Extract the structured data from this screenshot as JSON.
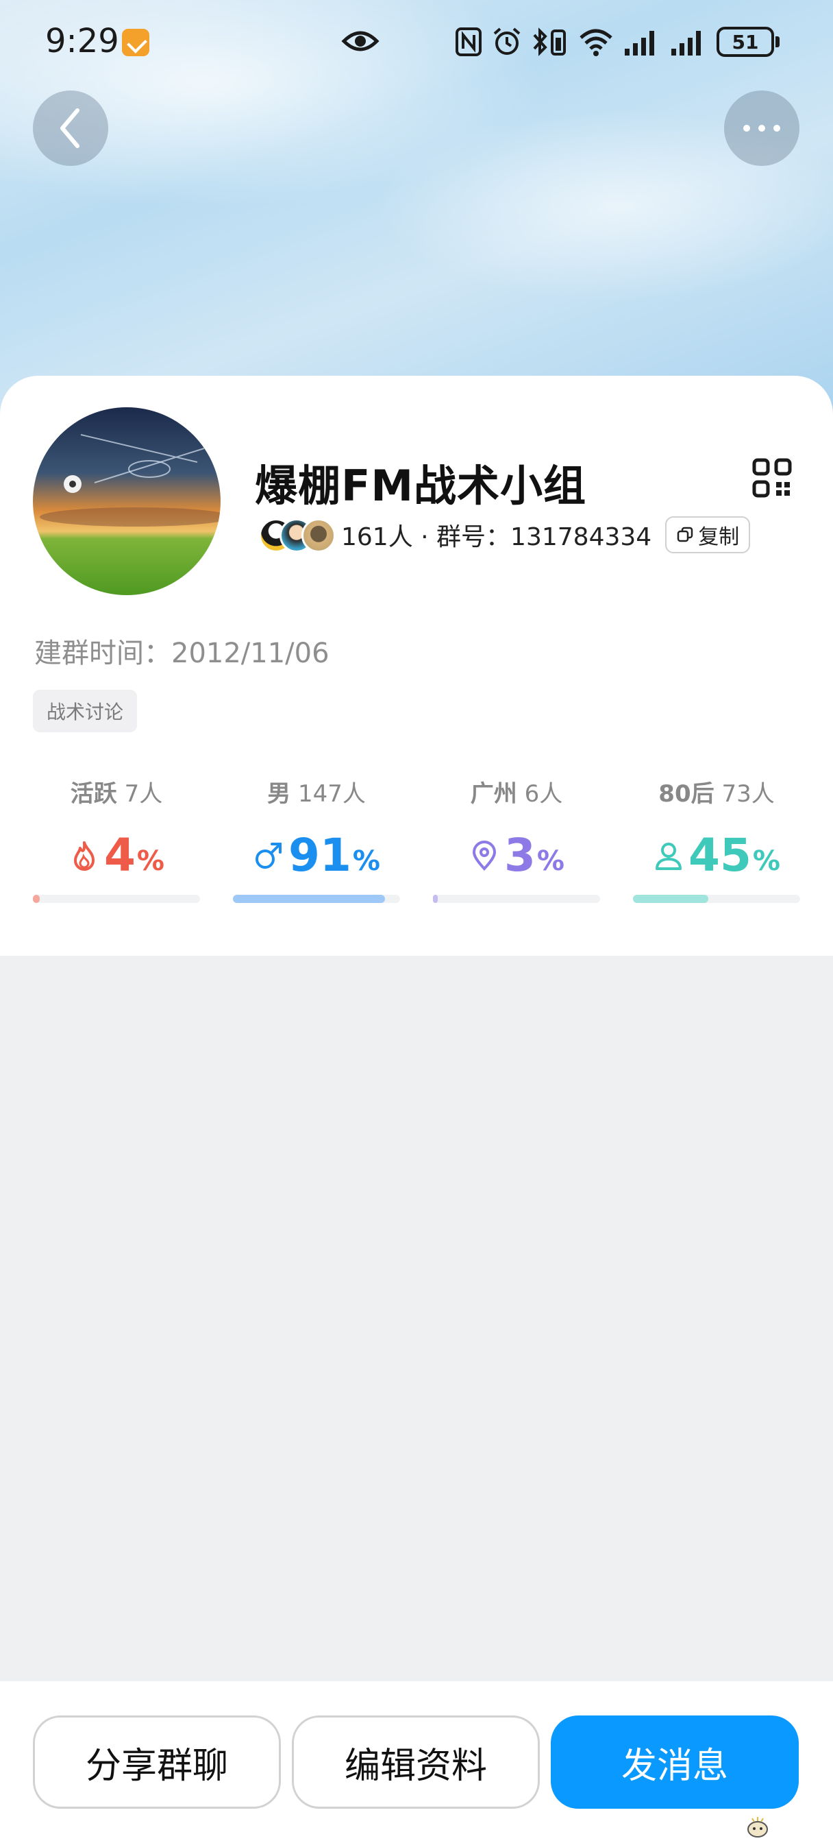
{
  "status_bar": {
    "time": "9:29",
    "battery": "51",
    "icons": [
      "app-notification-icon",
      "eye-icon",
      "nfc-icon",
      "alarm-icon",
      "bluetooth-icon",
      "wifi-icon",
      "signal-icon",
      "signal-icon",
      "battery-icon"
    ]
  },
  "nav": {
    "back_icon": "chevron-left-icon",
    "more_icon": "more-dots-icon"
  },
  "group": {
    "name": "爆棚FM战术小组",
    "member_count_text": "161人 · 群号：131784334",
    "copy_label": "复制",
    "founded_text": "建群时间：2012/11/06",
    "tag": "战术讨论"
  },
  "stats": [
    {
      "label": "活跃",
      "count": "7人",
      "value": "4",
      "unit": "%",
      "icon": "flame-icon",
      "color": "#ee5b48",
      "bar_color": "#f6a79c",
      "level": 0.04
    },
    {
      "label": "男",
      "count": "147人",
      "value": "91",
      "unit": "%",
      "icon": "male-icon",
      "color": "#1a8ff0",
      "bar_color": "#9ec8f7",
      "level": 0.91
    },
    {
      "label": "广州",
      "count": "6人",
      "value": "3",
      "unit": "%",
      "icon": "location-pin-icon",
      "color": "#8e7ae6",
      "bar_color": "#c6bcf2",
      "level": 0.03
    },
    {
      "label": "80后",
      "count": "73人",
      "value": "45",
      "unit": "%",
      "icon": "person-icon",
      "color": "#3ec9bb",
      "bar_color": "#9fe5dd",
      "level": 0.45
    }
  ],
  "actions": {
    "share": "分享群聊",
    "edit": "编辑资料",
    "send": "发消息"
  }
}
